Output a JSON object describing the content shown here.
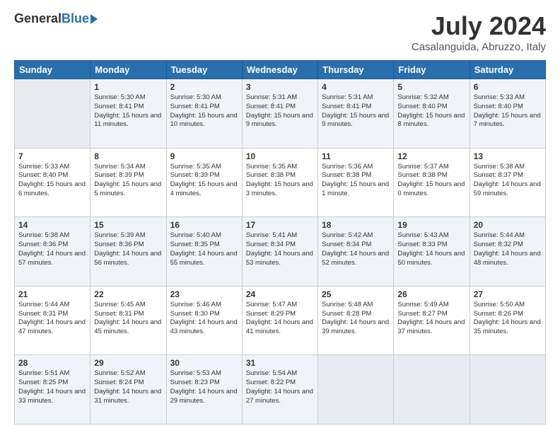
{
  "logo": {
    "general": "General",
    "blue": "Blue"
  },
  "title": "July 2024",
  "subtitle": "Casalanguida, Abruzzo, Italy",
  "days_of_week": [
    "Sunday",
    "Monday",
    "Tuesday",
    "Wednesday",
    "Thursday",
    "Friday",
    "Saturday"
  ],
  "weeks": [
    [
      {
        "day": "",
        "sunrise": "",
        "sunset": "",
        "daylight": ""
      },
      {
        "day": "1",
        "sunrise": "Sunrise: 5:30 AM",
        "sunset": "Sunset: 8:41 PM",
        "daylight": "Daylight: 15 hours and 11 minutes."
      },
      {
        "day": "2",
        "sunrise": "Sunrise: 5:30 AM",
        "sunset": "Sunset: 8:41 PM",
        "daylight": "Daylight: 15 hours and 10 minutes."
      },
      {
        "day": "3",
        "sunrise": "Sunrise: 5:31 AM",
        "sunset": "Sunset: 8:41 PM",
        "daylight": "Daylight: 15 hours and 9 minutes."
      },
      {
        "day": "4",
        "sunrise": "Sunrise: 5:31 AM",
        "sunset": "Sunset: 8:41 PM",
        "daylight": "Daylight: 15 hours and 9 minutes."
      },
      {
        "day": "5",
        "sunrise": "Sunrise: 5:32 AM",
        "sunset": "Sunset: 8:40 PM",
        "daylight": "Daylight: 15 hours and 8 minutes."
      },
      {
        "day": "6",
        "sunrise": "Sunrise: 5:33 AM",
        "sunset": "Sunset: 8:40 PM",
        "daylight": "Daylight: 15 hours and 7 minutes."
      }
    ],
    [
      {
        "day": "7",
        "sunrise": "Sunrise: 5:33 AM",
        "sunset": "Sunset: 8:40 PM",
        "daylight": "Daylight: 15 hours and 6 minutes."
      },
      {
        "day": "8",
        "sunrise": "Sunrise: 5:34 AM",
        "sunset": "Sunset: 8:39 PM",
        "daylight": "Daylight: 15 hours and 5 minutes."
      },
      {
        "day": "9",
        "sunrise": "Sunrise: 5:35 AM",
        "sunset": "Sunset: 8:39 PM",
        "daylight": "Daylight: 15 hours and 4 minutes."
      },
      {
        "day": "10",
        "sunrise": "Sunrise: 5:35 AM",
        "sunset": "Sunset: 8:38 PM",
        "daylight": "Daylight: 15 hours and 3 minutes."
      },
      {
        "day": "11",
        "sunrise": "Sunrise: 5:36 AM",
        "sunset": "Sunset: 8:38 PM",
        "daylight": "Daylight: 15 hours and 1 minute."
      },
      {
        "day": "12",
        "sunrise": "Sunrise: 5:37 AM",
        "sunset": "Sunset: 8:38 PM",
        "daylight": "Daylight: 15 hours and 0 minutes."
      },
      {
        "day": "13",
        "sunrise": "Sunrise: 5:38 AM",
        "sunset": "Sunset: 8:37 PM",
        "daylight": "Daylight: 14 hours and 59 minutes."
      }
    ],
    [
      {
        "day": "14",
        "sunrise": "Sunrise: 5:38 AM",
        "sunset": "Sunset: 8:36 PM",
        "daylight": "Daylight: 14 hours and 57 minutes."
      },
      {
        "day": "15",
        "sunrise": "Sunrise: 5:39 AM",
        "sunset": "Sunset: 8:36 PM",
        "daylight": "Daylight: 14 hours and 56 minutes."
      },
      {
        "day": "16",
        "sunrise": "Sunrise: 5:40 AM",
        "sunset": "Sunset: 8:35 PM",
        "daylight": "Daylight: 14 hours and 55 minutes."
      },
      {
        "day": "17",
        "sunrise": "Sunrise: 5:41 AM",
        "sunset": "Sunset: 8:34 PM",
        "daylight": "Daylight: 14 hours and 53 minutes."
      },
      {
        "day": "18",
        "sunrise": "Sunrise: 5:42 AM",
        "sunset": "Sunset: 8:34 PM",
        "daylight": "Daylight: 14 hours and 52 minutes."
      },
      {
        "day": "19",
        "sunrise": "Sunrise: 5:43 AM",
        "sunset": "Sunset: 8:33 PM",
        "daylight": "Daylight: 14 hours and 50 minutes."
      },
      {
        "day": "20",
        "sunrise": "Sunrise: 5:44 AM",
        "sunset": "Sunset: 8:32 PM",
        "daylight": "Daylight: 14 hours and 48 minutes."
      }
    ],
    [
      {
        "day": "21",
        "sunrise": "Sunrise: 5:44 AM",
        "sunset": "Sunset: 8:31 PM",
        "daylight": "Daylight: 14 hours and 47 minutes."
      },
      {
        "day": "22",
        "sunrise": "Sunrise: 5:45 AM",
        "sunset": "Sunset: 8:31 PM",
        "daylight": "Daylight: 14 hours and 45 minutes."
      },
      {
        "day": "23",
        "sunrise": "Sunrise: 5:46 AM",
        "sunset": "Sunset: 8:30 PM",
        "daylight": "Daylight: 14 hours and 43 minutes."
      },
      {
        "day": "24",
        "sunrise": "Sunrise: 5:47 AM",
        "sunset": "Sunset: 8:29 PM",
        "daylight": "Daylight: 14 hours and 41 minutes."
      },
      {
        "day": "25",
        "sunrise": "Sunrise: 5:48 AM",
        "sunset": "Sunset: 8:28 PM",
        "daylight": "Daylight: 14 hours and 39 minutes."
      },
      {
        "day": "26",
        "sunrise": "Sunrise: 5:49 AM",
        "sunset": "Sunset: 8:27 PM",
        "daylight": "Daylight: 14 hours and 37 minutes."
      },
      {
        "day": "27",
        "sunrise": "Sunrise: 5:50 AM",
        "sunset": "Sunset: 8:26 PM",
        "daylight": "Daylight: 14 hours and 35 minutes."
      }
    ],
    [
      {
        "day": "28",
        "sunrise": "Sunrise: 5:51 AM",
        "sunset": "Sunset: 8:25 PM",
        "daylight": "Daylight: 14 hours and 33 minutes."
      },
      {
        "day": "29",
        "sunrise": "Sunrise: 5:52 AM",
        "sunset": "Sunset: 8:24 PM",
        "daylight": "Daylight: 14 hours and 31 minutes."
      },
      {
        "day": "30",
        "sunrise": "Sunrise: 5:53 AM",
        "sunset": "Sunset: 8:23 PM",
        "daylight": "Daylight: 14 hours and 29 minutes."
      },
      {
        "day": "31",
        "sunrise": "Sunrise: 5:54 AM",
        "sunset": "Sunset: 8:22 PM",
        "daylight": "Daylight: 14 hours and 27 minutes."
      },
      {
        "day": "",
        "sunrise": "",
        "sunset": "",
        "daylight": ""
      },
      {
        "day": "",
        "sunrise": "",
        "sunset": "",
        "daylight": ""
      },
      {
        "day": "",
        "sunrise": "",
        "sunset": "",
        "daylight": ""
      }
    ]
  ]
}
